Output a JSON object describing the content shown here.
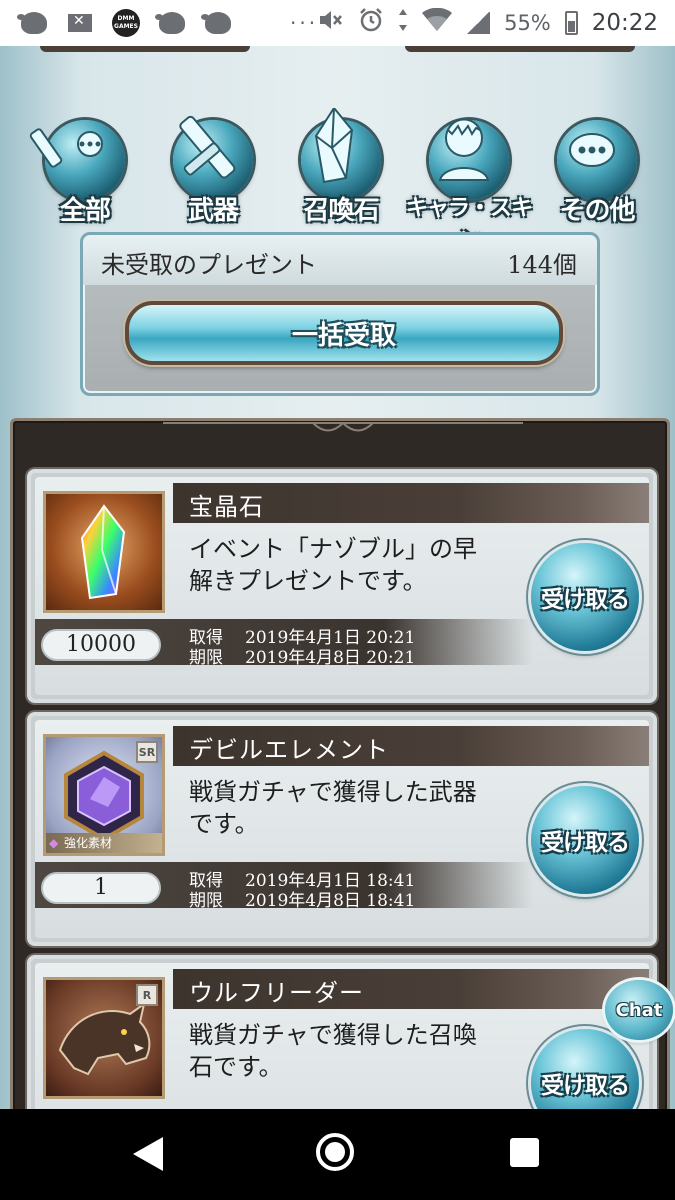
{
  "status_bar": {
    "time": "20:22",
    "battery": "55%",
    "dots": "···",
    "icons": [
      "bird-icon",
      "mail-blocked-icon",
      "dmm-games-icon",
      "bird-icon",
      "bird-icon",
      "mute-icon",
      "alarm-icon",
      "data-arrows-icon",
      "wifi-icon",
      "signal-icon",
      "battery-charging-icon"
    ],
    "dmm_text": "DMM GAMES"
  },
  "categories": [
    {
      "label": "全部",
      "icon": "all-icon"
    },
    {
      "label": "武器",
      "icon": "sword-icon"
    },
    {
      "label": "召喚石",
      "icon": "crystal-icon"
    },
    {
      "label": "キャラ・スキン",
      "icon": "character-icon"
    },
    {
      "label": "その他",
      "icon": "more-icon"
    }
  ],
  "unclaimed": {
    "title": "未受取のプレゼント",
    "count": "144個",
    "claim_all_label": "一括受取"
  },
  "gifts": [
    {
      "name": "宝晶石",
      "desc_line1": "イベント「ナゾブル」の早",
      "desc_line2": "解きプレゼントです。",
      "qty": "10000",
      "got_label": "取得",
      "got_date": "2019年4月1日  20:21",
      "exp_label": "期限",
      "exp_date": "2019年4月8日  20:21",
      "button": "受け取る",
      "icon": "rainbow-crystal-icon"
    },
    {
      "name": "デビルエレメント",
      "desc_line1": "戦貨ガチャで獲得した武器",
      "desc_line2": "です。",
      "qty": "1",
      "got_label": "取得",
      "got_date": "2019年4月1日  18:41",
      "exp_label": "期限",
      "exp_date": "2019年4月8日  18:41",
      "button": "受け取る",
      "icon": "purple-gem-icon",
      "rarity": "SR",
      "tag": "強化素材"
    },
    {
      "name": "ウルフリーダー",
      "desc_line1": "戦貨ガチャで獲得した召喚",
      "desc_line2": "石です。",
      "button": "受け取る",
      "icon": "wolf-icon",
      "rarity": "R"
    }
  ],
  "chat_label": "Chat",
  "colors": {
    "accent": "#3aa7c0",
    "panel": "#2f2925",
    "namebar": "#3d342e"
  }
}
